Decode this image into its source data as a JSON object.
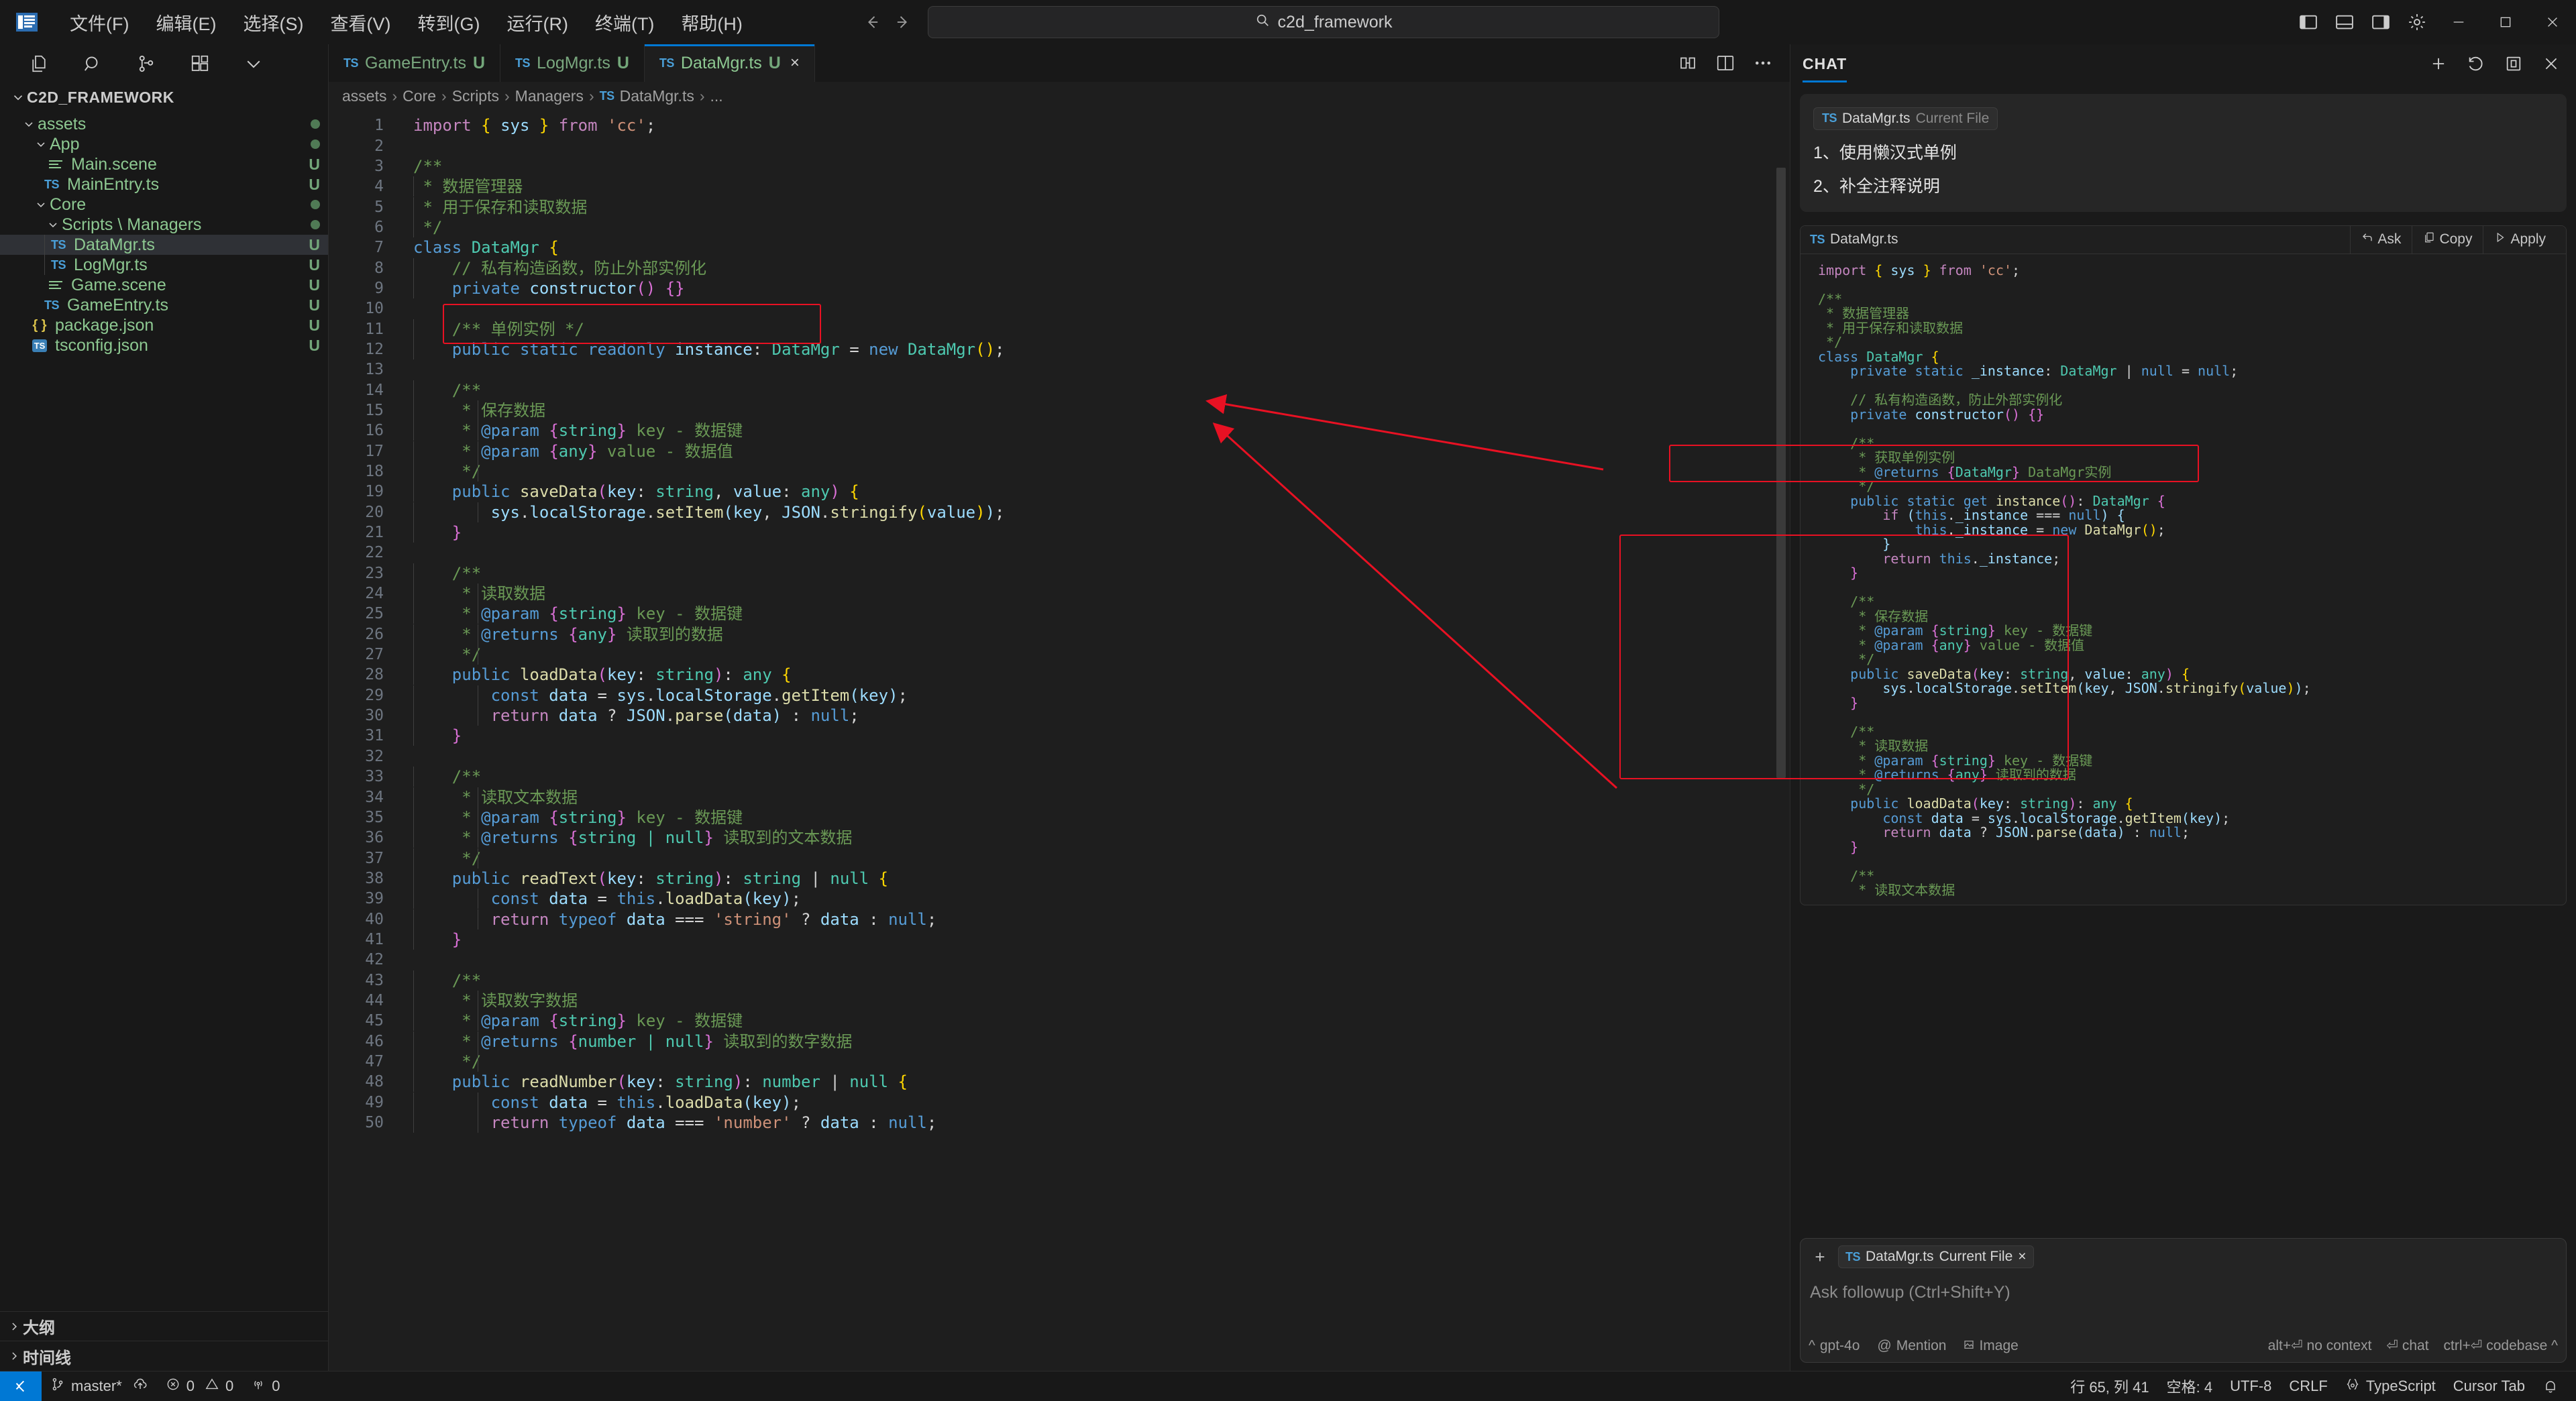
{
  "titlebar": {
    "app_icon": "vscode-logo-icon",
    "menus": [
      "文件(F)",
      "编辑(E)",
      "选择(S)",
      "查看(V)",
      "转到(G)",
      "运行(R)",
      "终端(T)",
      "帮助(H)"
    ],
    "search_value": "c2d_framework",
    "nav_back": "back-icon",
    "nav_forward": "forward-icon",
    "layout_icons": [
      "toggle-primary-sidebar-icon",
      "toggle-panel-icon",
      "toggle-secondary-sidebar-icon",
      "settings-gear-icon"
    ],
    "window_controls": [
      "minimize",
      "maximize",
      "close"
    ]
  },
  "sidebar": {
    "actions": [
      "new-file-icon",
      "search-icon",
      "source-control-icon",
      "extensions-icon",
      "more-actions-icon"
    ],
    "explorer_title": "C2D_FRAMEWORK",
    "tree": [
      {
        "label": "assets",
        "indent": 1,
        "type": "folder",
        "expanded": true,
        "badge": "dot"
      },
      {
        "label": "App",
        "indent": 2,
        "type": "folder",
        "expanded": true,
        "badge": "dot"
      },
      {
        "label": "Main.scene",
        "indent": 3,
        "type": "scene",
        "badge": "U"
      },
      {
        "label": "MainEntry.ts",
        "indent": 3,
        "type": "ts",
        "badge": "U"
      },
      {
        "label": "Core",
        "indent": 2,
        "type": "folder",
        "expanded": true,
        "badge": "dot"
      },
      {
        "label": "Scripts \\ Managers",
        "indent": 3,
        "type": "folder",
        "expanded": true,
        "badge": "dot"
      },
      {
        "label": "DataMgr.ts",
        "indent": 4,
        "type": "ts",
        "badge": "U",
        "selected": true
      },
      {
        "label": "LogMgr.ts",
        "indent": 4,
        "type": "ts",
        "badge": "U"
      },
      {
        "label": "Game.scene",
        "indent": 3,
        "type": "scene",
        "badge": "U"
      },
      {
        "label": "GameEntry.ts",
        "indent": 3,
        "type": "ts",
        "badge": "U"
      },
      {
        "label": "package.json",
        "indent": 2,
        "type": "json",
        "badge": "U"
      },
      {
        "label": "tsconfig.json",
        "indent": 2,
        "type": "tsconfig",
        "badge": "U"
      }
    ],
    "bottom_panels": [
      "大纲",
      "时间线"
    ]
  },
  "editor": {
    "tabs": [
      {
        "label": "GameEntry.ts",
        "status": "U",
        "active": false,
        "icon": "ts-file-icon"
      },
      {
        "label": "LogMgr.ts",
        "status": "U",
        "active": false,
        "icon": "ts-file-icon"
      },
      {
        "label": "DataMgr.ts",
        "status": "U",
        "active": true,
        "icon": "ts-file-icon",
        "close": "×"
      }
    ],
    "tab_actions": [
      "split-editor-icon",
      "open-changes-icon",
      "more-actions-icon"
    ],
    "breadcrumb": [
      "assets",
      "Core",
      "Scripts",
      "Managers",
      "DataMgr.ts",
      "..."
    ],
    "code_lines": [
      {
        "n": 1,
        "text": "import { sys } from 'cc';"
      },
      {
        "n": 2,
        "text": ""
      },
      {
        "n": 3,
        "text": "/**"
      },
      {
        "n": 4,
        "text": " * 数据管理器"
      },
      {
        "n": 5,
        "text": " * 用于保存和读取数据"
      },
      {
        "n": 6,
        "text": " */"
      },
      {
        "n": 7,
        "text": "class DataMgr {"
      },
      {
        "n": 8,
        "text": "    // 私有构造函数，防止外部实例化"
      },
      {
        "n": 9,
        "text": "    private constructor() {}"
      },
      {
        "n": 10,
        "text": ""
      },
      {
        "n": 11,
        "text": "    /** 单例实例 */"
      },
      {
        "n": 12,
        "text": "    public static readonly instance: DataMgr = new DataMgr();"
      },
      {
        "n": 13,
        "text": ""
      },
      {
        "n": 14,
        "text": "    /**"
      },
      {
        "n": 15,
        "text": "     * 保存数据"
      },
      {
        "n": 16,
        "text": "     * @param {string} key - 数据键"
      },
      {
        "n": 17,
        "text": "     * @param {any} value - 数据值"
      },
      {
        "n": 18,
        "text": "     */"
      },
      {
        "n": 19,
        "text": "    public saveData(key: string, value: any) {"
      },
      {
        "n": 20,
        "text": "        sys.localStorage.setItem(key, JSON.stringify(value));"
      },
      {
        "n": 21,
        "text": "    }"
      },
      {
        "n": 22,
        "text": ""
      },
      {
        "n": 23,
        "text": "    /**"
      },
      {
        "n": 24,
        "text": "     * 读取数据"
      },
      {
        "n": 25,
        "text": "     * @param {string} key - 数据键"
      },
      {
        "n": 26,
        "text": "     * @returns {any} 读取到的数据"
      },
      {
        "n": 27,
        "text": "     */"
      },
      {
        "n": 28,
        "text": "    public loadData(key: string): any {"
      },
      {
        "n": 29,
        "text": "        const data = sys.localStorage.getItem(key);"
      },
      {
        "n": 30,
        "text": "        return data ? JSON.parse(data) : null;"
      },
      {
        "n": 31,
        "text": "    }"
      },
      {
        "n": 32,
        "text": ""
      },
      {
        "n": 33,
        "text": "    /**"
      },
      {
        "n": 34,
        "text": "     * 读取文本数据"
      },
      {
        "n": 35,
        "text": "     * @param {string} key - 数据键"
      },
      {
        "n": 36,
        "text": "     * @returns {string | null} 读取到的文本数据"
      },
      {
        "n": 37,
        "text": "     */"
      },
      {
        "n": 38,
        "text": "    public readText(key: string): string | null {"
      },
      {
        "n": 39,
        "text": "        const data = this.loadData(key);"
      },
      {
        "n": 40,
        "text": "        return typeof data === 'string' ? data : null;"
      },
      {
        "n": 41,
        "text": "    }"
      },
      {
        "n": 42,
        "text": ""
      },
      {
        "n": 43,
        "text": "    /**"
      },
      {
        "n": 44,
        "text": "     * 读取数字数据"
      },
      {
        "n": 45,
        "text": "     * @param {string} key - 数据键"
      },
      {
        "n": 46,
        "text": "     * @returns {number | null} 读取到的数字数据"
      },
      {
        "n": 47,
        "text": "     */"
      },
      {
        "n": 48,
        "text": "    public readNumber(key: string): number | null {"
      },
      {
        "n": 49,
        "text": "        const data = this.loadData(key);"
      },
      {
        "n": 50,
        "text": "        return typeof data === 'number' ? data : null;"
      }
    ],
    "highlight_label": "singleton-instance-highlight"
  },
  "chat": {
    "title": "CHAT",
    "header_icons": [
      "new-chat-icon",
      "history-icon",
      "open-editor-icon",
      "close-icon"
    ],
    "message": {
      "context_chip": {
        "file": "DataMgr.ts",
        "scope": "Current File",
        "icon": "ts-file-icon"
      },
      "lines": [
        "1、使用懒汉式单例",
        "2、补全注释说明"
      ]
    },
    "codeblock": {
      "filename": "DataMgr.ts",
      "actions": [
        {
          "label": "Ask",
          "icon": "ask-arrow-icon"
        },
        {
          "label": "Copy",
          "icon": "copy-icon"
        },
        {
          "label": "Apply",
          "icon": "play-icon"
        }
      ],
      "lines": [
        "import { sys } from 'cc';",
        "",
        "/**",
        " * 数据管理器",
        " * 用于保存和读取数据",
        " */",
        "class DataMgr {",
        "    private static _instance: DataMgr | null = null;",
        "",
        "    // 私有构造函数，防止外部实例化",
        "    private constructor() {}",
        "",
        "    /**",
        "     * 获取单例实例",
        "     * @returns {DataMgr} DataMgr实例",
        "     */",
        "    public static get instance(): DataMgr {",
        "        if (this._instance === null) {",
        "            this._instance = new DataMgr();",
        "        }",
        "        return this._instance;",
        "    }",
        "",
        "    /**",
        "     * 保存数据",
        "     * @param {string} key - 数据键",
        "     * @param {any} value - 数据值",
        "     */",
        "    public saveData(key: string, value: any) {",
        "        sys.localStorage.setItem(key, JSON.stringify(value));",
        "    }",
        "",
        "    /**",
        "     * 读取数据",
        "     * @param {string} key - 数据键",
        "     * @returns {any} 读取到的数据",
        "     */",
        "    public loadData(key: string): any {",
        "        const data = sys.localStorage.getItem(key);",
        "        return data ? JSON.parse(data) : null;",
        "    }",
        "",
        "    /**",
        "     * 读取文本数据"
      ]
    },
    "input": {
      "add_context_icon": "plus-icon",
      "context_chip": {
        "file": "DataMgr.ts",
        "scope": "Current File",
        "remove": "×"
      },
      "placeholder": "Ask followup (Ctrl+Shift+Y)",
      "model": "gpt-4o",
      "mention": "Mention",
      "image": "Image",
      "hint_no_context": "alt+⏎ no context",
      "hint_chat": "⏎ chat",
      "hint_codebase": "ctrl+⏎ codebase ^"
    }
  },
  "status_bar": {
    "remote_icon": "remote-window-icon",
    "branch": "master*",
    "sync_icon": "cloud-upload-icon",
    "errors": "0",
    "warnings": "0",
    "ports": "0",
    "cursor_position": "行 65, 列 41",
    "indentation": "空格: 4",
    "encoding": "UTF-8",
    "eol": "CRLF",
    "language": "TypeScript",
    "cursor_tab": "Cursor Tab",
    "bell_icon": "notifications-bell-icon",
    "accent": "#0078d4"
  },
  "colors": {
    "accent": "#0078d4",
    "highlight_box": "#e81123",
    "bg": "#1e1e1e",
    "chrome": "#181818"
  }
}
